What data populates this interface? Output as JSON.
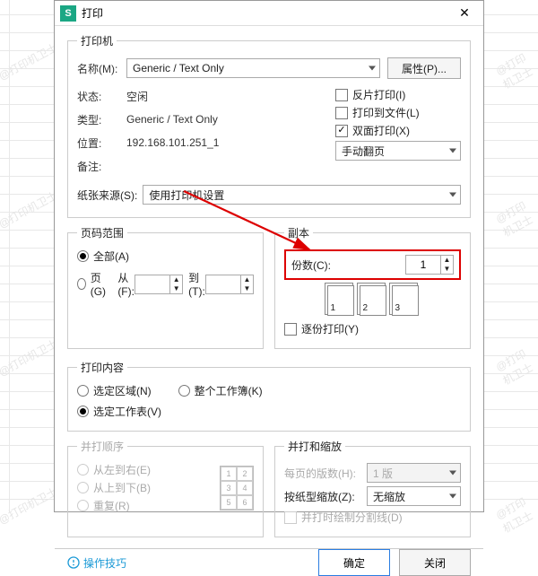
{
  "window": {
    "logo": "S",
    "title": "打印",
    "close": "✕"
  },
  "printer": {
    "legend": "打印机",
    "name_label": "名称(M):",
    "name_value": "Generic / Text Only",
    "props_btn": "属性(P)...",
    "status_label": "状态:",
    "status_value": "空闲",
    "type_label": "类型:",
    "type_value": "Generic / Text Only",
    "where_label": "位置:",
    "where_value": "192.168.101.251_1",
    "comment_label": "备注:",
    "reverse": "反片打印(I)",
    "tofile": "打印到文件(L)",
    "duplex": "双面打印(X)",
    "flip_value": "手动翻页",
    "source_label": "纸张来源(S):",
    "source_value": "使用打印机设置"
  },
  "range": {
    "legend": "页码范围",
    "all": "全部(A)",
    "pages": "页(G)",
    "from": "从(F):",
    "to": "到(T):"
  },
  "copies": {
    "legend": "副本",
    "count_label": "份数(C):",
    "count_value": "1",
    "collate": "逐份打印(Y)"
  },
  "content": {
    "legend": "打印内容",
    "selection": "选定区域(N)",
    "workbook": "整个工作簿(K)",
    "sheets": "选定工作表(V)"
  },
  "order": {
    "legend": "并打顺序",
    "lr": "从左到右(E)",
    "tb": "从上到下(B)",
    "repeat": "重复(R)"
  },
  "scaling": {
    "legend": "并打和缩放",
    "perpage_label": "每页的版数(H):",
    "perpage_value": "1 版",
    "scale_label": "按纸型缩放(Z):",
    "scale_value": "无缩放",
    "gridlines": "并打时绘制分割线(D)"
  },
  "footer": {
    "tips": "操作技巧",
    "ok": "确定",
    "cancel": "关闭"
  }
}
